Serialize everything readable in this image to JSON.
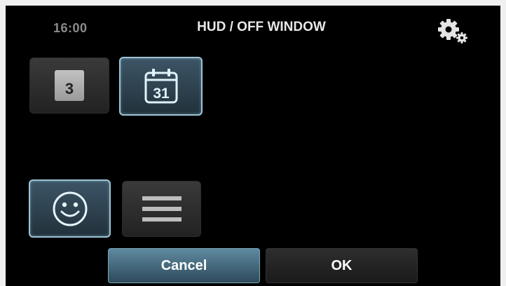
{
  "header": {
    "clock": "16:00",
    "title": "HUD / OFF WINDOW",
    "settings_icon": "gears-icon"
  },
  "tiles": {
    "day_number": "3",
    "calendar_day": "31",
    "calendar_icon": "calendar-icon",
    "smiley_icon": "smiley-icon",
    "list_icon": "list-lines-icon"
  },
  "buttons": {
    "cancel_label": "Cancel",
    "ok_label": "OK"
  },
  "colors": {
    "background": "#000000",
    "selected_border": "#9cc4d6",
    "cancel_accent": "#4f7a90"
  }
}
